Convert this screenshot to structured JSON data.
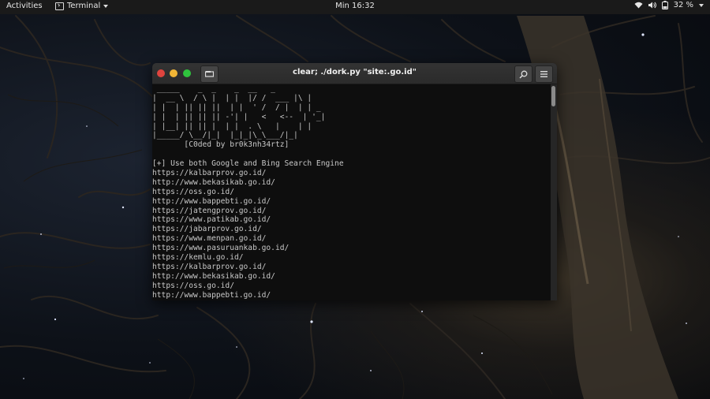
{
  "topbar": {
    "activities": "Activities",
    "app_name": "Terminal",
    "clock": "Min 16:32",
    "battery": "32 %"
  },
  "window": {
    "title": "clear; ./dork.py \"site:.go.id\"",
    "banner": [
      " _____    _  _    _  __   _",
      "|  __ \\  / \\ |  | |  |/ /  ___ |\\ |",
      "| |  | || || ||  | |  ' /  / |  | | _",
      "| |  | || || || -'| |   <   <--  | '_|",
      "| |__| || || |  | |  . \\   |    | |",
      "|_____/ \\__/|_|  |_|_|\\_\\___/|_|"
    ],
    "credit": "       [C0ded by br0k3nh34rtz]",
    "info": "[+] Use both Google and Bing Search Engine",
    "results": [
      "https://kalbarprov.go.id/",
      "http://www.bekasikab.go.id/",
      "https://oss.go.id/",
      "http://www.bappebti.go.id/",
      "https://jatengprov.go.id/",
      "https://www.patikab.go.id/",
      "https://jabarprov.go.id/",
      "https://www.menpan.go.id/",
      "https://www.pasuruankab.go.id/",
      "https://kemlu.go.id/",
      "https://kalbarprov.go.id/",
      "http://www.bekasikab.go.id/",
      "https://oss.go.id/",
      "http://www.bappebti.go.id/"
    ]
  },
  "colors": {
    "close": "#e0443e",
    "minimize": "#f2b636",
    "maximize": "#2fc43d",
    "terminal_bg": "#0e0e0e",
    "terminal_fg": "#c8c8c8"
  }
}
